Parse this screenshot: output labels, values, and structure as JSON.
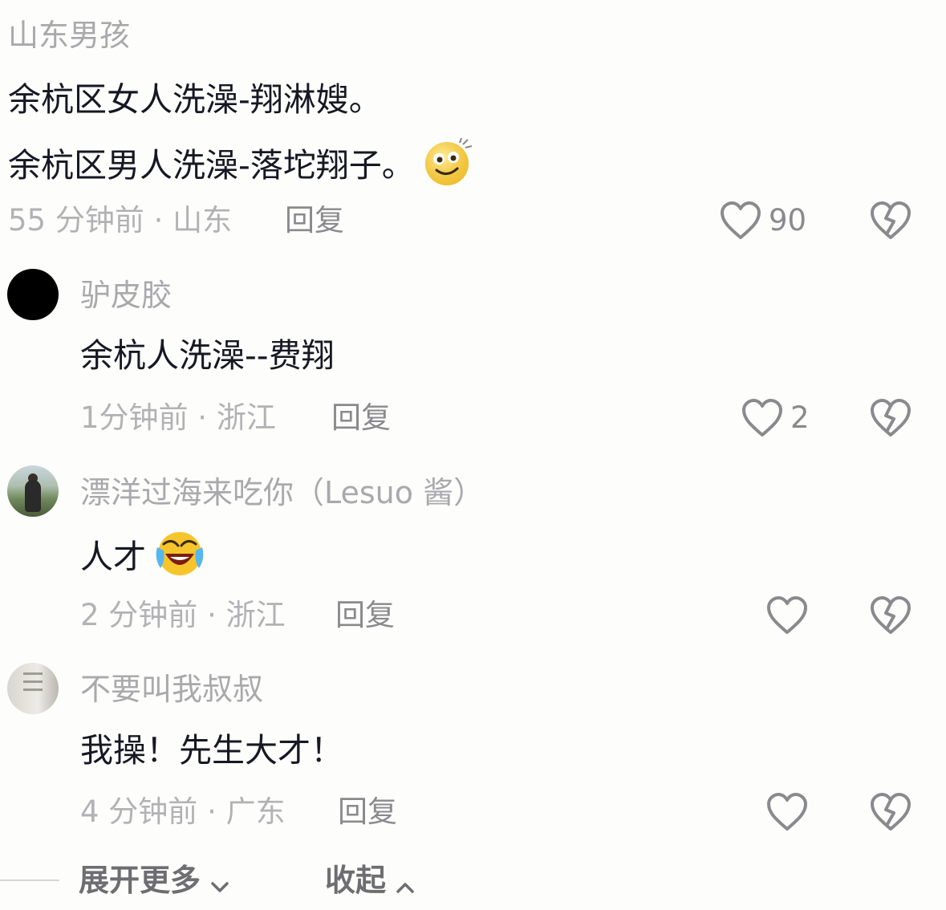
{
  "comments": [
    {
      "username": "山东男孩",
      "lines": [
        "余杭区女人洗澡-翔淋嫂。",
        "余杭区男人洗澡-落坨翔子。"
      ],
      "emoji": "smile-emoji",
      "time_location": "55 分钟前 · 山东",
      "reply_label": "回复",
      "likes": "90"
    },
    {
      "username": "驴皮胶",
      "lines": [
        "余杭人洗澡--费翔"
      ],
      "time_location": "1分钟前 · 浙江",
      "reply_label": "回复",
      "likes": "2"
    },
    {
      "username": "漂洋过海来吃你（Lesuo 酱）",
      "lines": [
        "人才"
      ],
      "emoji": "laugh-cry-emoji",
      "time_location": "2 分钟前 · 浙江",
      "reply_label": "回复",
      "likes": ""
    },
    {
      "username": "不要叫我叔叔",
      "lines": [
        "我操！先生大才！"
      ],
      "time_location": "4 分钟前 · 广东",
      "reply_label": "回复",
      "likes": ""
    }
  ],
  "footer": {
    "expand_label": "展开更多",
    "collapse_label": "收起"
  },
  "icons": {
    "like": "heart-outline-icon",
    "dislike": "broken-heart-icon",
    "expand": "chevron-down-icon",
    "collapse": "chevron-up-icon"
  },
  "colors": {
    "text_primary": "#161823",
    "text_secondary": "#a9a9ad",
    "icon": "#8a8a8e",
    "background": "#fdfdfb"
  }
}
